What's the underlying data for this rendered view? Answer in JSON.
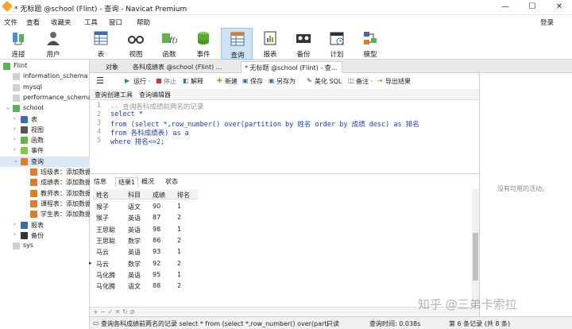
{
  "window": {
    "title": "* 无标题 @school (Flint) - 查询 - Navicat Premium",
    "min": "—",
    "max": "☐",
    "close": "✕"
  },
  "menu": [
    "文件",
    "查看",
    "收藏夹",
    "工具",
    "窗口",
    "帮助"
  ],
  "login": "登录",
  "toolbar": [
    "连接",
    "用户",
    "表",
    "视图",
    "函数",
    "事件",
    "查询",
    "报表",
    "备份",
    "计划",
    "模型"
  ],
  "sidebar": {
    "rows": [
      "Flint",
      "information_schema",
      "mysql",
      "performance_schema",
      "school",
      "表",
      "视图",
      "函数",
      "事件",
      "查询",
      "班级表：添加数据",
      "成绩表：添加数据",
      "教师表：添加数据",
      "课程表：添加数据",
      "学生表：添加数据",
      "报表",
      "备份",
      "sys"
    ]
  },
  "tabs": [
    "对象",
    "各科成绩表 @school (Flint) ...",
    "* 无标题 @school (Flint) - 查..."
  ],
  "qtoolbar": {
    "run": "运行 ·",
    "stop": "停止",
    "explain": "解释",
    "new": "新建",
    "save": "保存",
    "saveas": "另存为",
    "beautify": "美化 SQL",
    "note": "备注 ·",
    "export": "导出结果"
  },
  "subtabs": [
    "查询创建工具",
    "查询编辑器"
  ],
  "editor": {
    "lines": [
      {
        "n": "1",
        "t": "-- 查询各科成绩前两名的记录"
      },
      {
        "n": "2",
        "t": "select *"
      },
      {
        "n": "3",
        "t": "from (select *,row_number() over(partition by 姓名 order by 成绩 desc) as 排名"
      },
      {
        "n": "4",
        "t": "from 各科成绩表) as a"
      },
      {
        "n": "5",
        "t": "where 排名<=2;"
      }
    ]
  },
  "right_panel": {
    "empty_text": "没有可用的活动。"
  },
  "result_tabs": [
    "信息",
    "结果1",
    "概况",
    "状态"
  ],
  "grid": {
    "headers": [
      "姓名",
      "科目",
      "成绩",
      "排名"
    ],
    "rows": [
      [
        "猴子",
        "语文",
        "90",
        "1"
      ],
      [
        "猴子",
        "英语",
        "87",
        "2"
      ],
      [
        "王思聪",
        "英语",
        "98",
        "1"
      ],
      [
        "王思聪",
        "数学",
        "86",
        "2"
      ],
      [
        "马云",
        "英语",
        "93",
        "1"
      ],
      [
        "马云",
        "数学",
        "92",
        "2"
      ],
      [
        "马化腾",
        "英语",
        "95",
        "1"
      ],
      [
        "马化腾",
        "语文",
        "88",
        "2"
      ]
    ]
  },
  "gridfoot": "+ − ✓ ✕ ↻ ⊘",
  "status": {
    "sql": "查询各科成绩前两名的记录 select * from (select *,row_number() over(parti",
    "readonly": "只读",
    "time": "查询时间: 0.038s",
    "record": "第 6 条记录 (共 8 条)"
  },
  "watermark": "知乎 @三弟卡索拉"
}
